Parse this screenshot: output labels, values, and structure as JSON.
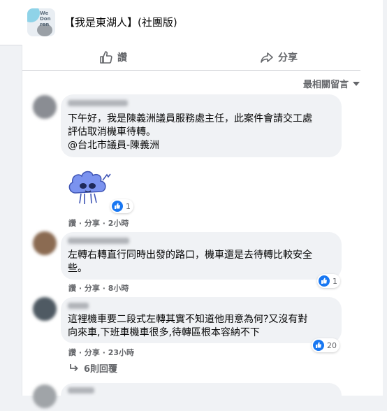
{
  "header": {
    "group_name": "【我是東湖人】(社團版)"
  },
  "actions": {
    "like_label": "讚",
    "share_label": "分享"
  },
  "sort": {
    "label": "最相關留言"
  },
  "comments": [
    {
      "text_line1": "下午好，我是陳義洲議員服務處主任，此案件會請交工處",
      "text_line2": "評估取消機車待轉。",
      "text_line3": "@台北市議員-陳義洲",
      "reaction_count": "1",
      "meta": {
        "like": "讚",
        "sep": "·",
        "share": "分享",
        "time": "2小時"
      }
    },
    {
      "text_line1": "左轉右轉直行同時出發的路口，機車還是去待轉比較安全",
      "text_line2": "些。",
      "reaction_count": "1",
      "meta": {
        "like": "讚",
        "sep": "·",
        "share": "分享",
        "time": "8小時"
      }
    },
    {
      "text_line1": "這裡機車要二段式左轉其實不知道他用意為何?又沒有對",
      "text_line2": "向來車,下班車機車很多,待轉區根本容納不下",
      "reaction_count": "20",
      "meta": {
        "like": "讚",
        "sep": "·",
        "share": "分享",
        "time": "23小時"
      },
      "replies_label": "6則回覆"
    }
  ],
  "colors": {
    "accent": "#1877f2",
    "meta": "#65676b",
    "bubble": "#f0f2f5"
  }
}
